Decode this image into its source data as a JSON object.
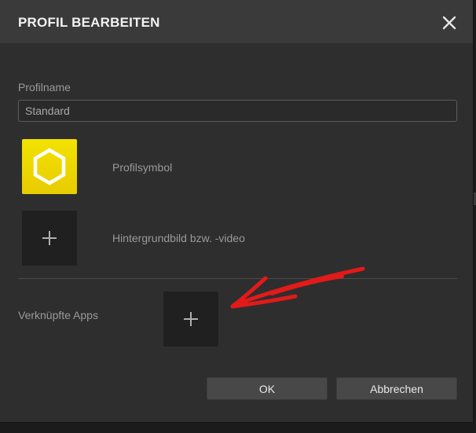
{
  "dialog": {
    "title": "PROFIL BEARBEITEN",
    "close_icon": "close-icon"
  },
  "profile_name": {
    "label": "Profilname",
    "value": "Standard"
  },
  "profile_symbol": {
    "label": "Profilsymbol",
    "icon": "hexagon-icon",
    "color": "#f0dc00"
  },
  "background": {
    "label": "Hintergrundbild bzw. -video",
    "icon": "plus-icon"
  },
  "linked_apps": {
    "label": "Verknüpfte Apps",
    "icon": "plus-icon"
  },
  "buttons": {
    "ok": "OK",
    "cancel": "Abbrechen"
  },
  "annotation": {
    "color": "#e21a1a"
  }
}
